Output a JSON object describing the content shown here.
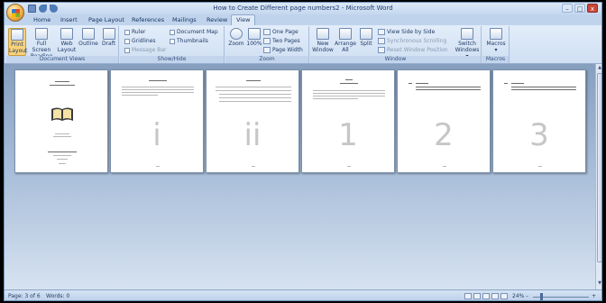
{
  "window": {
    "title": "How to Create Different page numbers2 - Microsoft Word",
    "controls": [
      "–",
      "□",
      "x"
    ]
  },
  "tabs": [
    "Home",
    "Insert",
    "Page Layout",
    "References",
    "Mailings",
    "Review",
    "View"
  ],
  "active_tab": "View",
  "ribbon": {
    "document_views": {
      "label": "Document Views",
      "buttons": [
        {
          "label": "Print Layout",
          "line1": "Print",
          "line2": "Layout",
          "selected": true
        },
        {
          "label": "Full Screen Reading",
          "line1": "Full Screen",
          "line2": "Reading"
        },
        {
          "label": "Web Layout",
          "line1": "Web",
          "line2": "Layout"
        },
        {
          "label": "Outline",
          "line1": "Outline",
          "line2": ""
        },
        {
          "label": "Draft",
          "line1": "Draft",
          "line2": ""
        }
      ]
    },
    "show_hide": {
      "label": "Show/Hide",
      "items": [
        {
          "label": "Ruler",
          "enabled": true
        },
        {
          "label": "Gridlines",
          "enabled": true
        },
        {
          "label": "Message Bar",
          "enabled": false
        },
        {
          "label": "Document Map",
          "enabled": true
        },
        {
          "label": "Thumbnails",
          "enabled": true
        }
      ]
    },
    "zoom": {
      "label": "Zoom",
      "zoom_button": "Zoom",
      "percent_button": "100%",
      "one_page": "One Page",
      "two_pages": "Two Pages",
      "page_width": "Page Width"
    },
    "window_group": {
      "label": "Window",
      "new_window": {
        "line1": "New",
        "line2": "Window"
      },
      "arrange_all": {
        "line1": "Arrange",
        "line2": "All"
      },
      "split": "Split",
      "view_side_by_side": "View Side by Side",
      "synchronous_scrolling": "Synchronous Scrolling",
      "reset_window_position": "Reset Window Position",
      "switch_windows": {
        "line1": "Switch",
        "line2": "Windows ▾"
      }
    },
    "macros": {
      "label": "Macros",
      "button": "Macros",
      "arrow": "▾"
    }
  },
  "pages": [
    {
      "number": ""
    },
    {
      "number": "i"
    },
    {
      "number": "ii"
    },
    {
      "number": "1"
    },
    {
      "number": "2"
    },
    {
      "number": "3"
    }
  ],
  "status": {
    "page": "Page: 3 of 6",
    "words": "Words: 0",
    "zoom_percent": "24%",
    "zoom_level": 0.24,
    "zoom_minus": "–",
    "zoom_plus": "+"
  },
  "colors": {
    "accent": "#f9d27a",
    "ribbon": "#dfeaf8",
    "workspace": "#a6bcd8"
  },
  "icons": [
    "office-button",
    "save-icon",
    "undo-icon",
    "redo-icon",
    "book-icon",
    "scroll-up-icon",
    "scroll-down-icon"
  ]
}
